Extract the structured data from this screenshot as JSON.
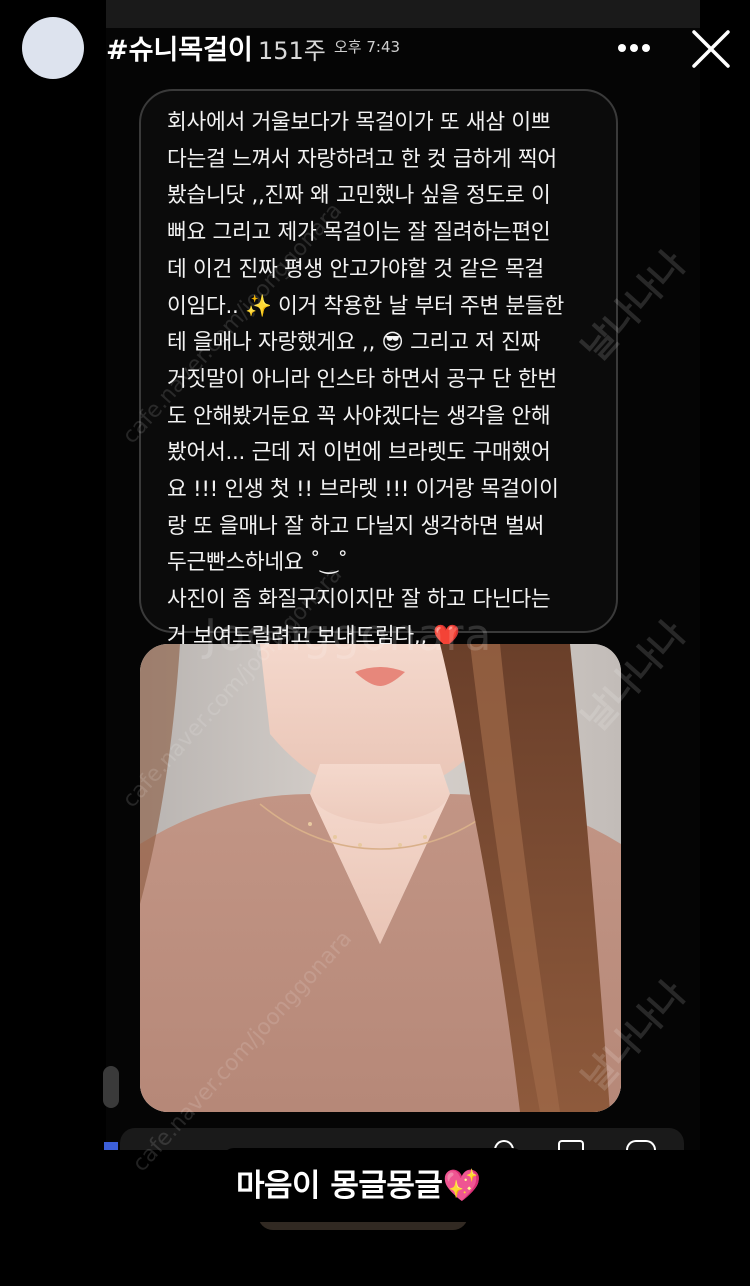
{
  "header": {
    "username": "#슈니목걸이",
    "age": "151주",
    "time": "오후 7:43"
  },
  "message": {
    "text": "회사에서 거울보다가 목걸이가 또 새삼 이쁘\n다는걸 느껴서 자랑하려고 한 컷 급하게 찍어\n봤습니닷 ,,진짜 왜 고민했나 싶을 정도로 이\n뻐요 그리고 제가 목걸이는 잘 질려하는편인\n데 이건 진짜 평생 안고가야할 것 같은 목걸\n이임다.. ✨ 이거 착용한 날 부터 주변 분들한\n테 을매나 자랑했게요 ,, 😎 그리고 저 진짜\n거짓말이 아니라 인스타 하면서 공구 단 한번\n도 안해봤거둔요 꼭 사야겠다는 생각을 안해\n봤어서... 근데 저 이번에 브라렛도 구매했어\n요 !!! 인생 첫 !! 브라렛 !!! 이거랑 목걸이이\n랑 또 을매나 잘 하고 다닐지 생각하면 벌써\n두근빤스하네요 ˚‿˚\n사진이 좀 화질구지이지만 잘 하고 다닌다는\n거 보여드릴려고 보내드림다,, ❤️"
  },
  "caption": {
    "text": "마음이 몽글몽글",
    "emoji": "💖"
  },
  "watermarks": {
    "brand": "Joonggonara",
    "cafe": "cafe.naver.com/joonggonara",
    "korean": "날나나나"
  },
  "icons": {
    "more": "more-horizontal-icon",
    "close": "close-icon"
  },
  "colors": {
    "background": "#000000",
    "bubble_border": "#3a3a3a",
    "heart": "#e0262b"
  }
}
